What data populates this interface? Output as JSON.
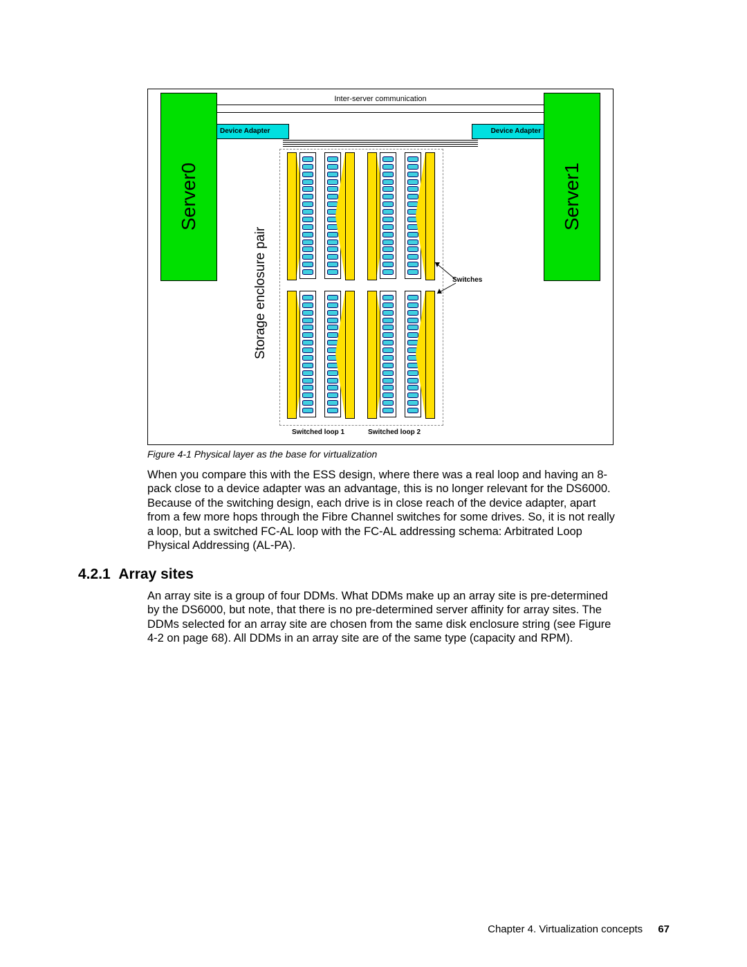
{
  "figure": {
    "inter_server_label": "Inter-server communication",
    "server0_label": "Server0",
    "server1_label": "Server1",
    "device_adapter_label": "Device Adapter",
    "storage_pair_label": "Storage enclosure pair",
    "switches_label": "Switches",
    "loop1_label": "Switched loop 1",
    "loop2_label": "Switched loop 2"
  },
  "caption": "Figure 4-1   Physical layer as the base for virtualization",
  "paragraph1": "When you compare this with the ESS design, where there was a real loop and having an 8-pack close to a device adapter was an advantage, this is no longer relevant for the DS6000. Because of the switching design, each drive is in close reach of the device adapter, apart from a few more hops through the Fibre Channel switches for some drives. So, it is not really a loop, but a switched FC-AL loop with the FC-AL addressing schema: Arbitrated Loop Physical Addressing (AL-PA).",
  "section_number": "4.2.1",
  "section_title": "Array sites",
  "paragraph2": "An array site is a group of four DDMs. What DDMs make up an array site is pre-determined by the DS6000, but note, that there is no pre-determined server affinity for array sites. The DDMs selected for an array site are chosen from the same disk enclosure string (see Figure 4-2 on page 68). All DDMs in an array site are of the same type (capacity and RPM).",
  "footer": {
    "chapter": "Chapter 4. Virtualization concepts",
    "page": "67"
  }
}
